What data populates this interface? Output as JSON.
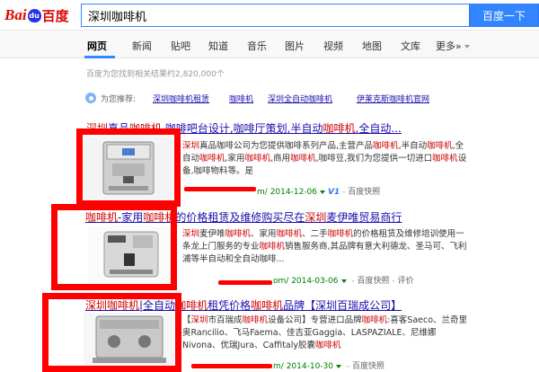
{
  "logo": {
    "bai": "Bai",
    "du": "du",
    "cn": "百度"
  },
  "search": {
    "query": "深圳咖啡机",
    "button_label": "百度一下"
  },
  "tabs": [
    "网页",
    "新闻",
    "贴吧",
    "知道",
    "音乐",
    "图片",
    "视频",
    "地图",
    "文库",
    "更多»"
  ],
  "result_count": "百度为您找到相关结果约2,820,000个",
  "recommend": {
    "label": "为您推荐:",
    "links": [
      "深圳咖啡机租赁",
      "咖啡机",
      "深圳全自动咖啡机",
      "伊莱克斯咖啡机官网"
    ]
  },
  "results": [
    {
      "title": {
        "p1": "深圳",
        "p2": "真品",
        "p3": "咖啡机",
        "p4": " 咖啡吧台设计,咖啡厅策划,半自动",
        "p5": "咖啡机",
        "p6": ",全自动..."
      },
      "abstract": [
        {
          "t": "深圳",
          "h": true
        },
        {
          "t": "真品咖啡公司为您提供咖啡系列产品,主营产品"
        },
        {
          "t": "咖啡机",
          "h": true
        },
        {
          "t": ",半自动"
        },
        {
          "t": "咖啡机",
          "h": true
        },
        {
          "t": ",全自动"
        },
        {
          "t": "咖啡机",
          "h": true
        },
        {
          "t": ",家用"
        },
        {
          "t": "咖啡机",
          "h": true
        },
        {
          "t": ",商用"
        },
        {
          "t": "咖啡机",
          "h": true
        },
        {
          "t": ",咖啡豆,我们为您提供一切进口"
        },
        {
          "t": "咖啡机",
          "h": true
        },
        {
          "t": "设备,咖啡物料等。是"
        }
      ],
      "url_tail": "m/",
      "date": "2014-12-06",
      "badge": "V",
      "badge_num": "1",
      "kuaizhao": "百度快照",
      "pingjia": ""
    },
    {
      "title": {
        "p1": "咖啡机",
        "p2": "-家用",
        "p3": "咖啡机",
        "p4": "的价格租赁及维修购买尽在",
        "p5": "深圳",
        "p6": "麦伊唯贸易商行"
      },
      "abstract": [
        {
          "t": "深圳",
          "h": true
        },
        {
          "t": "麦伊唯"
        },
        {
          "t": "咖啡机",
          "h": true
        },
        {
          "t": "、家用"
        },
        {
          "t": "咖啡机",
          "h": true
        },
        {
          "t": "、二手"
        },
        {
          "t": "咖啡机",
          "h": true
        },
        {
          "t": "的价格租赁及维修培训使用一条龙上门服务的专业"
        },
        {
          "t": "咖啡机",
          "h": true
        },
        {
          "t": "销售服务商,其品牌有意大利德龙、圣马可、飞利浦等半自动和全自动咖啡..."
        }
      ],
      "url_tail": "om/",
      "date": "2014-03-06",
      "badge": "",
      "badge_num": "",
      "kuaizhao": "百度快照",
      "pingjia": "评价"
    },
    {
      "title": {
        "p1": "深圳咖啡机",
        "p2": "|全自动",
        "p3": "咖啡机",
        "p4": "租凭价格",
        "p5": "咖啡机",
        "p6": "品牌【深圳百瑞成公司】"
      },
      "abstract": [
        {
          "t": "【"
        },
        {
          "t": "深圳",
          "h": true
        },
        {
          "t": "市百瑞成"
        },
        {
          "t": "咖啡机",
          "h": true
        },
        {
          "t": "设备公司】专营进口品牌"
        },
        {
          "t": "咖啡机",
          "h": true
        },
        {
          "t": ":喜客Saeco、兰奇里奥Rancilio、飞马Faema、佳吉亚Gaggia、LASPAZIALE、尼维娜Nivona、优瑞Jura、Caffitaly胶囊"
        },
        {
          "t": "咖啡机",
          "h": true
        }
      ],
      "url_tail": "m/",
      "date": "2014-10-30",
      "badge": "",
      "badge_num": "",
      "kuaizhao": "百度快照",
      "pingjia": ""
    }
  ],
  "colors": {
    "link": "#1a0dab",
    "highlight": "#cc0000",
    "url": "#008000",
    "annotation_red": "#ff0000",
    "brand_blue": "#3385ff"
  }
}
